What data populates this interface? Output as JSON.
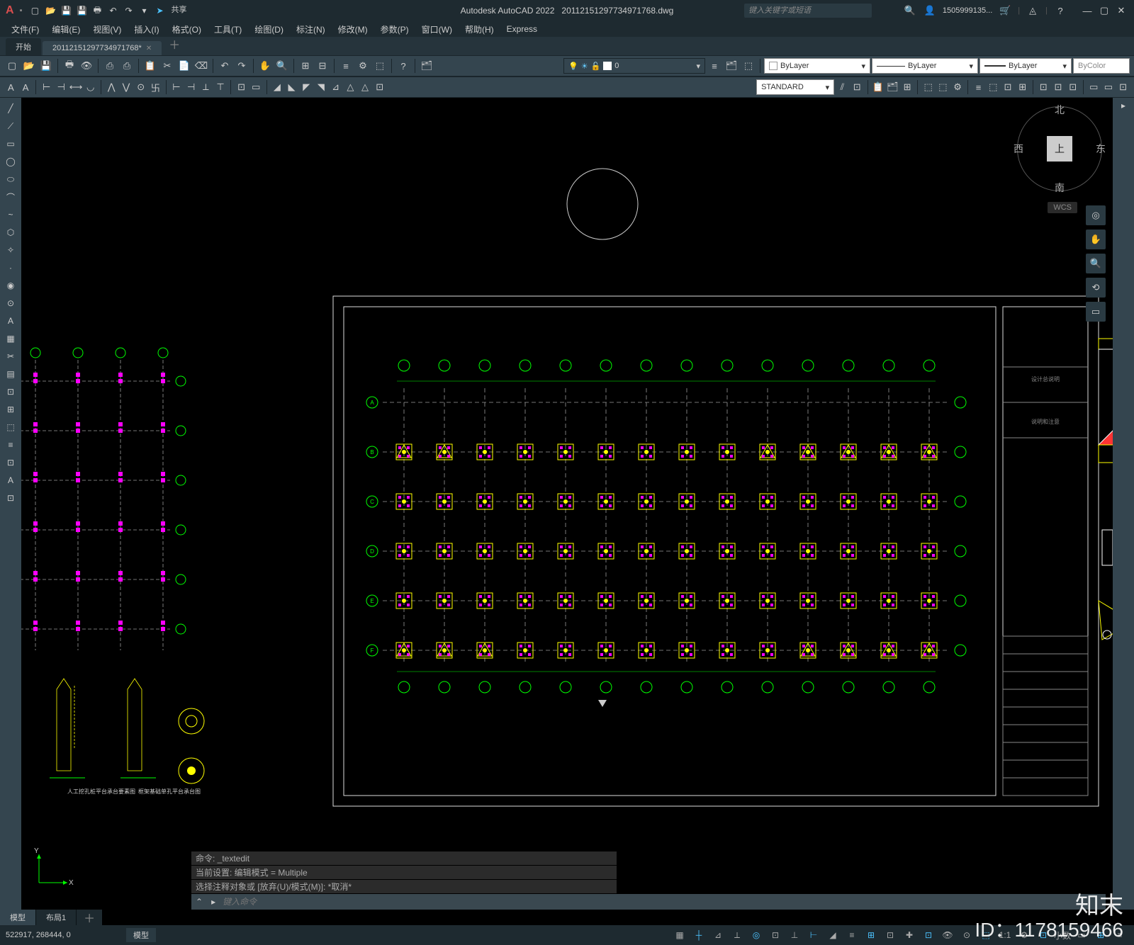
{
  "title": {
    "app": "Autodesk AutoCAD 2022",
    "file": "20112151297734971768.dwg"
  },
  "search": {
    "placeholder": "键入关键字或短语"
  },
  "user": {
    "name": "1505999135..."
  },
  "menu": [
    "文件(F)",
    "编辑(E)",
    "视图(V)",
    "插入(I)",
    "格式(O)",
    "工具(T)",
    "绘图(D)",
    "标注(N)",
    "修改(M)",
    "参数(P)",
    "窗口(W)",
    "帮助(H)",
    "Express"
  ],
  "doctabs": {
    "start": "开始",
    "active": "20112151297734971768*"
  },
  "layer": {
    "current": "0",
    "by1": "ByLayer",
    "by2": "ByLayer",
    "by3": "ByLayer",
    "bycolor": "ByColor"
  },
  "textstyle": "STANDARD",
  "viewcube": {
    "top": "上",
    "n": "北",
    "s": "南",
    "e": "东",
    "w": "西",
    "wcs": "WCS"
  },
  "cmd": {
    "hist1": "命令: _textedit",
    "hist2": "当前设置: 编辑模式 = Multiple",
    "hist3": "选择注释对象或 [放弃(U)/模式(M)]: *取消*",
    "prompt_icon": "▸",
    "placeholder": "键入命令"
  },
  "mtabs": {
    "model": "模型",
    "layout": "布局1"
  },
  "status": {
    "coords": "522917, 268444, 0",
    "space": "模型",
    "scale": "1:1",
    "decimal": "小数"
  },
  "watermark": {
    "brand": "知末",
    "id": "ID：1178159466"
  },
  "share": "共享"
}
